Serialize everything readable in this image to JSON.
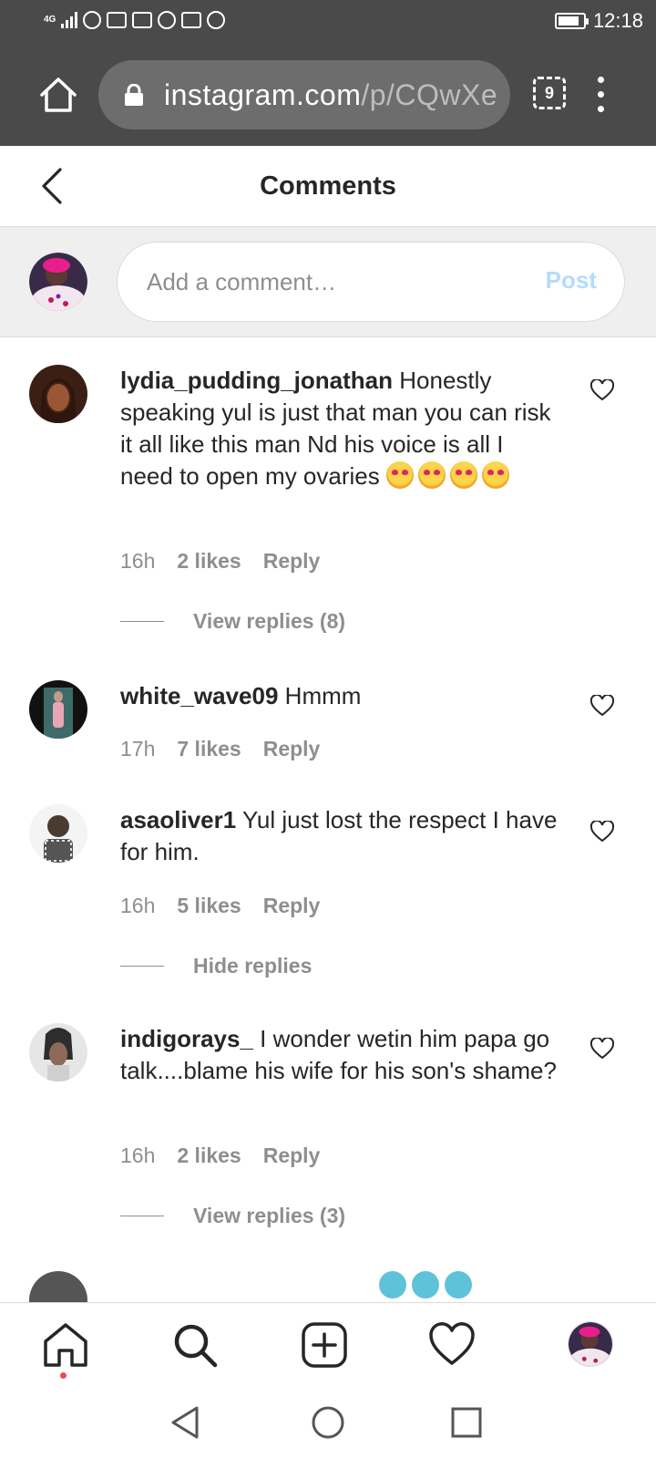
{
  "status_bar": {
    "network": "4G",
    "time": "12:18"
  },
  "browser": {
    "url_domain": "instagram.com",
    "url_path": "/p/CQwXe",
    "tab_count": "9"
  },
  "header": {
    "title": "Comments"
  },
  "composer": {
    "placeholder": "Add a comment…",
    "post_label": "Post"
  },
  "comments": [
    {
      "username": "lydia_pudding_jonathan",
      "text": "Honestly speaking yul is just that man you can risk it all like this man Nd his voice is all I need to open my ovaries",
      "emoji_count": 4,
      "time": "16h",
      "likes": "2 likes",
      "reply": "Reply",
      "replies_link": "View replies (8)"
    },
    {
      "username": "white_wave09",
      "text": "Hmmm",
      "time": "17h",
      "likes": "7 likes",
      "reply": "Reply"
    },
    {
      "username": "asaoliver1",
      "text": "Yul just lost the respect I have for him.",
      "time": "16h",
      "likes": "5 likes",
      "reply": "Reply",
      "replies_link": "Hide replies"
    },
    {
      "username": "indigorays_",
      "text": "I wonder wetin him papa go talk....blame his wife for his son's shame?",
      "time": "16h",
      "likes": "2 likes",
      "reply": "Reply",
      "replies_link": "View replies (3)"
    }
  ],
  "colors": {
    "accent_disabled": "#b3dbff",
    "notification_dot": "#ed4956",
    "chrome_bar": "#4a4a4a"
  },
  "icons": {
    "bottom_nav": [
      "home-icon",
      "search-icon",
      "new-post-icon",
      "activity-heart-icon",
      "profile-avatar"
    ],
    "system_nav": [
      "back-triangle-icon",
      "home-circle-icon",
      "recents-square-icon"
    ]
  }
}
